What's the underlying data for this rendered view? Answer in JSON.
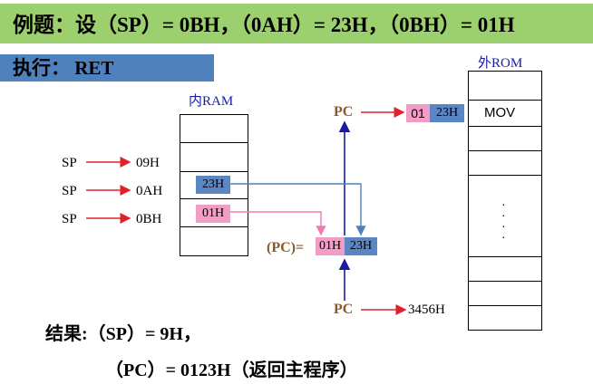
{
  "title": "例题：设（SP）= 0BH，（0AH）= 23H，（0BH）= 01H",
  "exec": "执行： RET",
  "ram_label": "内RAM",
  "rom_label": "外ROM",
  "sp_label": "SP",
  "sp_addrs": [
    "09H",
    "0AH",
    "0BH"
  ],
  "ram_values": {
    "addr_0a": "23H",
    "addr_0b": "01H"
  },
  "pc_label": "PC",
  "pc_eq_label": "(PC)=",
  "pc_high": "01H",
  "pc_low": "23H",
  "top_pc_high": "01",
  "top_pc_low": "23H",
  "rom_first": "MOV",
  "rom_dots": "·",
  "old_pc": "3456H",
  "result_line1": "结果:（SP）= 9H，",
  "result_line2": "（PC）= 0123H（返回主程序）",
  "colors": {
    "title_bar": "#9ccf6d",
    "exec_bar": "#4f81bd",
    "pink": "#f39cc6",
    "blue": "#5b86c4",
    "arrow_red": "#e0202a",
    "arrow_blue": "#1a1aa6",
    "pc_brown": "#8a5a2b"
  }
}
